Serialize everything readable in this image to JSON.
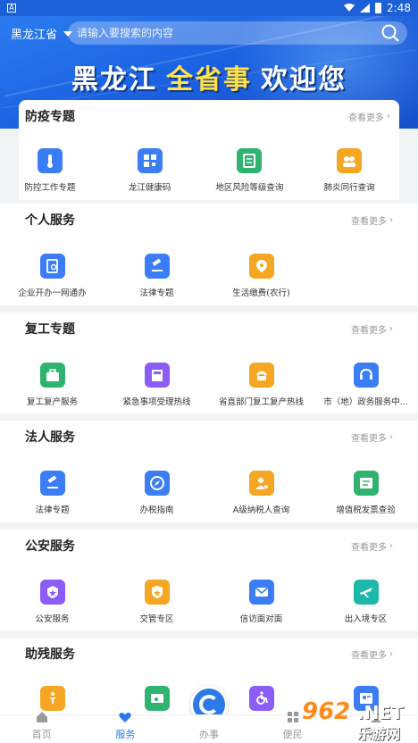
{
  "status": {
    "time": "2:48"
  },
  "header": {
    "province": "黑龙江省",
    "search_placeholder": "请输入要搜索的内容",
    "banner": {
      "part1": "黑龙江",
      "part2": "全省事",
      "part3": "欢迎您"
    }
  },
  "more_label": "查看更多",
  "sections": [
    {
      "title": "防疫专题",
      "items": [
        {
          "label": "防控工作专题",
          "icon": "thermometer-icon",
          "color": "#3b7df5"
        },
        {
          "label": "龙江健康码",
          "icon": "qrcode-icon",
          "color": "#3b7df5"
        },
        {
          "label": "地区风险等级查询",
          "icon": "document-icon",
          "color": "#2fb36f"
        },
        {
          "label": "肺炎同行查询",
          "icon": "people-icon",
          "color": "#f5a623"
        }
      ]
    },
    {
      "title": "个人服务",
      "items": [
        {
          "label": "企业开办一网通办",
          "icon": "document-search-icon",
          "color": "#3b7df5"
        },
        {
          "label": "法律专题",
          "icon": "gavel-icon",
          "color": "#3b7df5"
        },
        {
          "label": "生活缴费(农行)",
          "icon": "location-icon",
          "color": "#f5a623"
        }
      ]
    },
    {
      "title": "复工专题",
      "items": [
        {
          "label": "复工复产服务",
          "icon": "briefcase-icon",
          "color": "#2fb36f"
        },
        {
          "label": "紧急事项受理热线",
          "icon": "fax-icon",
          "color": "#8b5cf6"
        },
        {
          "label": "省直部门复工复产热线",
          "icon": "phone-icon",
          "color": "#f5a623"
        },
        {
          "label": "市（地）政务服务中...",
          "icon": "headset-icon",
          "color": "#3b7df5"
        }
      ]
    },
    {
      "title": "法人服务",
      "items": [
        {
          "label": "法律专题",
          "icon": "gavel-icon",
          "color": "#3b7df5"
        },
        {
          "label": "办税指南",
          "icon": "compass-icon",
          "color": "#3b7df5"
        },
        {
          "label": "A级纳税人查询",
          "icon": "person-badge-icon",
          "color": "#f5a623"
        },
        {
          "label": "增值税发票查验",
          "icon": "invoice-icon",
          "color": "#2fb36f"
        }
      ]
    },
    {
      "title": "公安服务",
      "items": [
        {
          "label": "公安服务",
          "icon": "police-badge-icon",
          "color": "#8b5cf6"
        },
        {
          "label": "交管专区",
          "icon": "shield-icon",
          "color": "#f5a623"
        },
        {
          "label": "信访面对面",
          "icon": "mail-icon",
          "color": "#3b7df5"
        },
        {
          "label": "出入境专区",
          "icon": "plane-icon",
          "color": "#1fb8a8"
        }
      ]
    },
    {
      "title": "助残服务",
      "items": [
        {
          "label": "",
          "icon": "accessibility-icon",
          "color": "#f5a623"
        },
        {
          "label": "",
          "icon": "card-icon",
          "color": "#2fb36f"
        },
        {
          "label": "",
          "icon": "wheelchair-icon",
          "color": "#8b5cf6"
        },
        {
          "label": "",
          "icon": "id-card-icon",
          "color": "#3b7df5"
        }
      ]
    }
  ],
  "tabs": [
    {
      "label": "首页",
      "icon": "home-icon"
    },
    {
      "label": "服务",
      "icon": "heart-icon",
      "active": true
    },
    {
      "label": "办事",
      "icon": "circle-icon"
    },
    {
      "label": "便民",
      "icon": "grid-icon"
    },
    {
      "label": "我的",
      "icon": "user-icon"
    }
  ],
  "watermark": {
    "num": "962",
    "net": ".NET",
    "cn": "乐游网"
  }
}
